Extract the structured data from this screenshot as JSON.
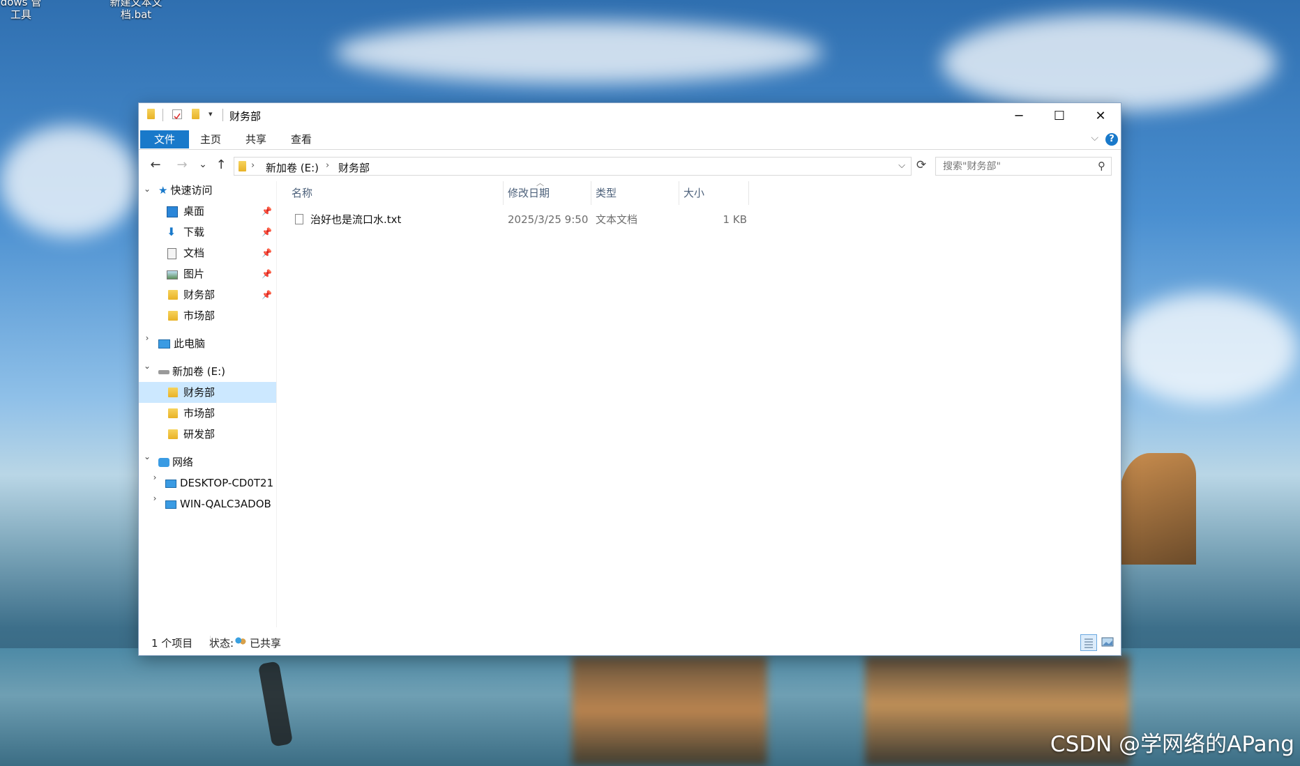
{
  "desktop": {
    "icon1_label": "dows 管\n工具",
    "icon2_label": "新建文本文\n档.bat",
    "watermark": "CSDN @学网络的APang"
  },
  "window": {
    "title": "财务部",
    "controls": {
      "minimize": "─",
      "maximize": "☐",
      "close": "✕"
    }
  },
  "ribbon": {
    "tabs": [
      "文件",
      "主页",
      "共享",
      "查看"
    ]
  },
  "nav": {
    "back": "←",
    "forward": "→",
    "recent": "⌄",
    "up": "↑",
    "path": [
      "新加卷 (E:)",
      "财务部"
    ],
    "refresh": "⟳",
    "search_placeholder": "搜索\"财务部\""
  },
  "sidebar": {
    "quick_access": "快速访问",
    "quick_items": [
      "桌面",
      "下载",
      "文档",
      "图片",
      "财务部",
      "市场部"
    ],
    "this_pc": "此电脑",
    "drive": "新加卷 (E:)",
    "drive_items": [
      "财务部",
      "市场部",
      "研发部"
    ],
    "network": "网络",
    "network_items": [
      "DESKTOP-CD0T21",
      "WIN-QALC3ADOB"
    ]
  },
  "columns": [
    "名称",
    "修改日期",
    "类型",
    "大小"
  ],
  "files": [
    {
      "name": "治好也是流口水.txt",
      "modified": "2025/3/25 9:50",
      "type": "文本文档",
      "size": "1 KB"
    }
  ],
  "status": {
    "count": "1 个项目",
    "state_label": "状态:",
    "state_value": "已共享"
  },
  "colors": {
    "accent": "#1979ca",
    "selected": "#cce8ff",
    "folder": "#f2c744"
  }
}
